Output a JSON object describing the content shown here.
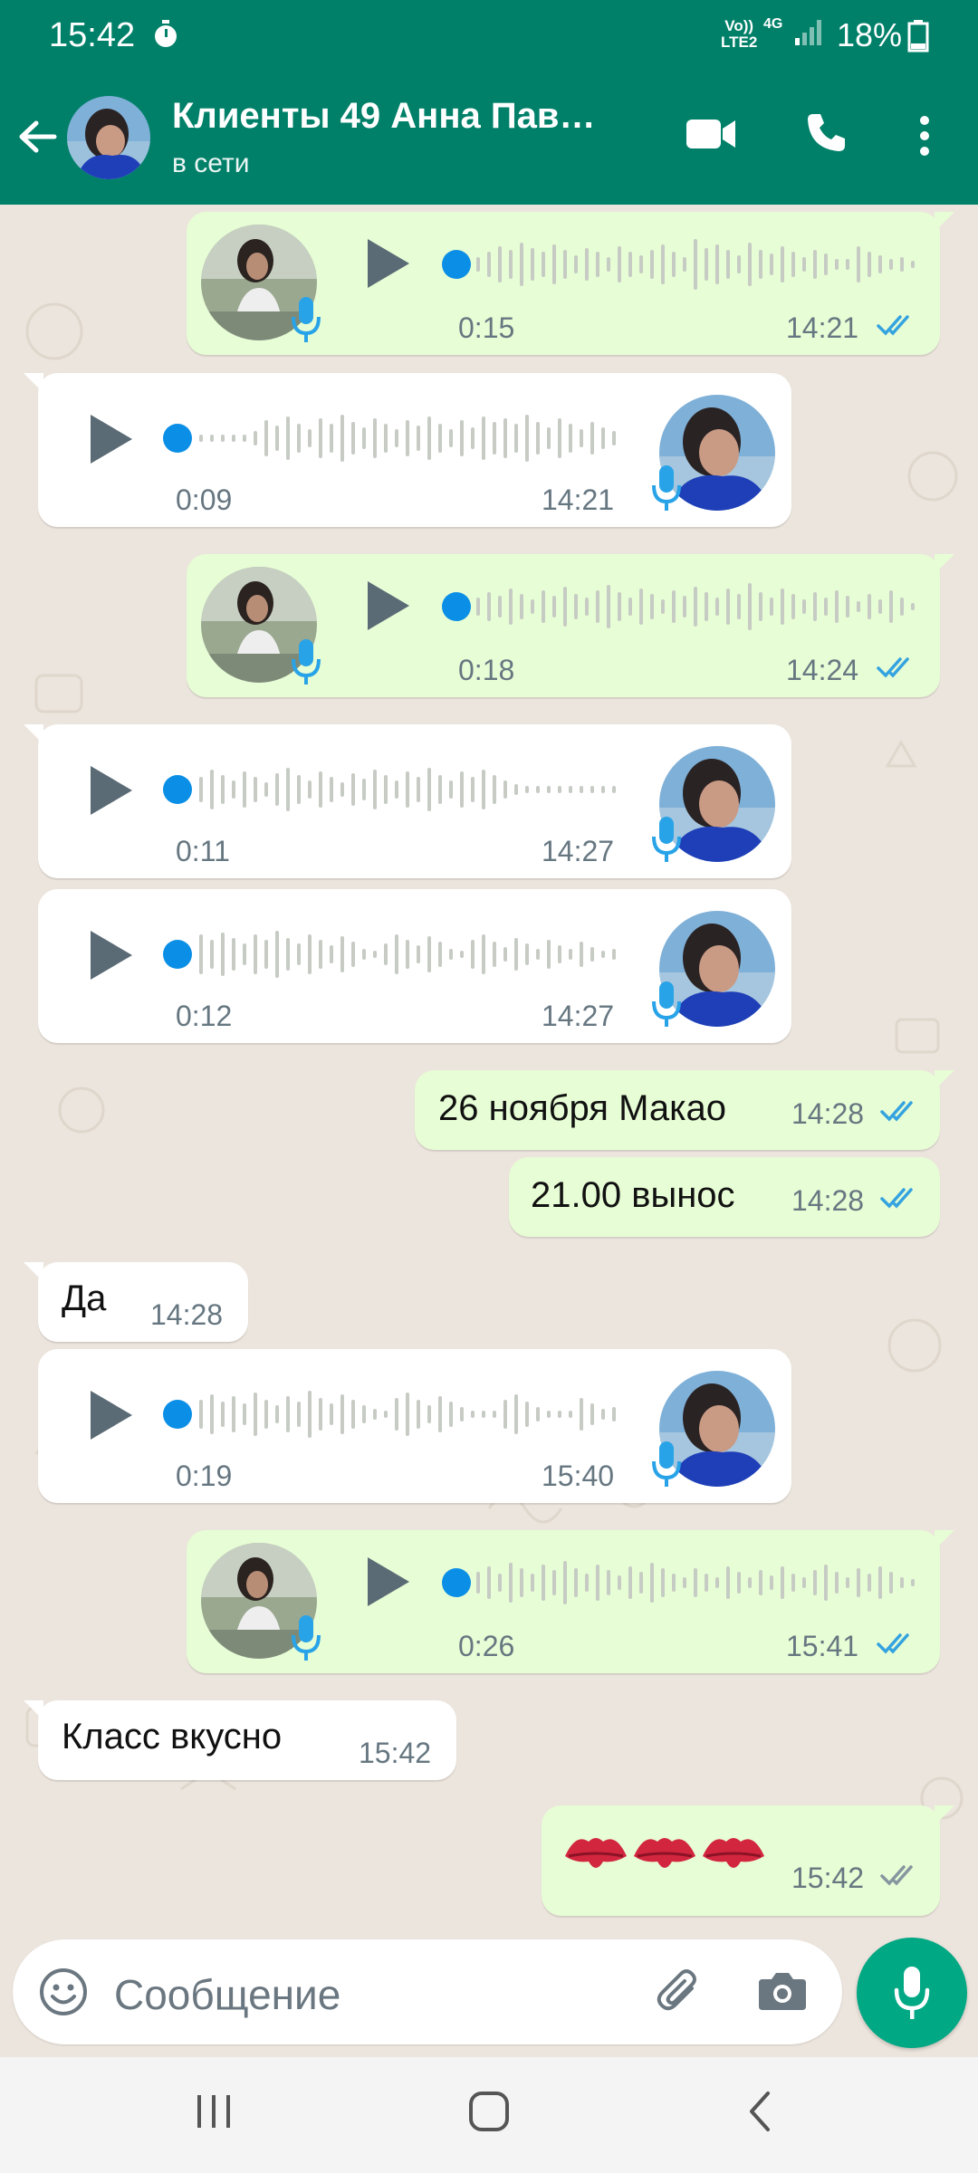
{
  "status_bar": {
    "time": "15:42",
    "network_line1": "Vo))",
    "network_line2": "LTE2",
    "network_type": "4G",
    "battery": "18%"
  },
  "header": {
    "title": "Клиенты 49 Анна Пав…",
    "status": "в сети",
    "icons": [
      "back-arrow-icon",
      "video-call-icon",
      "phone-icon",
      "more-options-icon"
    ]
  },
  "colors": {
    "header": "#008069",
    "outgoing_bubble": "#e7fdd5",
    "incoming_bubble": "#ffffff",
    "chat_background": "#ece5dd",
    "read_ticks": "#34a3e0",
    "mic_fab": "#00a884"
  },
  "messages": [
    {
      "direction": "out",
      "type": "voice",
      "duration": "0:15",
      "time": "14:21",
      "status": "read"
    },
    {
      "direction": "in",
      "type": "voice",
      "duration": "0:09",
      "time": "14:21"
    },
    {
      "direction": "out",
      "type": "voice",
      "duration": "0:18",
      "time": "14:24",
      "status": "read"
    },
    {
      "direction": "in",
      "type": "voice",
      "duration": "0:11",
      "time": "14:27"
    },
    {
      "direction": "in",
      "type": "voice",
      "duration": "0:12",
      "time": "14:27"
    },
    {
      "direction": "out",
      "type": "text",
      "text": "26 ноября Макао",
      "time": "14:28",
      "status": "read"
    },
    {
      "direction": "out",
      "type": "text",
      "text": "21.00 вынос",
      "time": "14:28",
      "status": "read"
    },
    {
      "direction": "in",
      "type": "text",
      "text": "Да",
      "time": "14:28"
    },
    {
      "direction": "in",
      "type": "voice",
      "duration": "0:19",
      "time": "15:40"
    },
    {
      "direction": "out",
      "type": "voice",
      "duration": "0:26",
      "time": "15:41",
      "status": "read"
    },
    {
      "direction": "in",
      "type": "text",
      "text": "Класс вкусно",
      "time": "15:42"
    },
    {
      "direction": "out",
      "type": "emoji",
      "emoji_count": 3,
      "emoji_name": "kiss-mark",
      "time": "15:42",
      "status": "delivered"
    }
  ],
  "composer": {
    "placeholder": "Сообщение",
    "icons": [
      "emoji-icon",
      "attach-icon",
      "camera-icon",
      "mic-icon"
    ]
  },
  "navbar": {
    "icons": [
      "recents-icon",
      "home-icon",
      "back-icon"
    ]
  }
}
